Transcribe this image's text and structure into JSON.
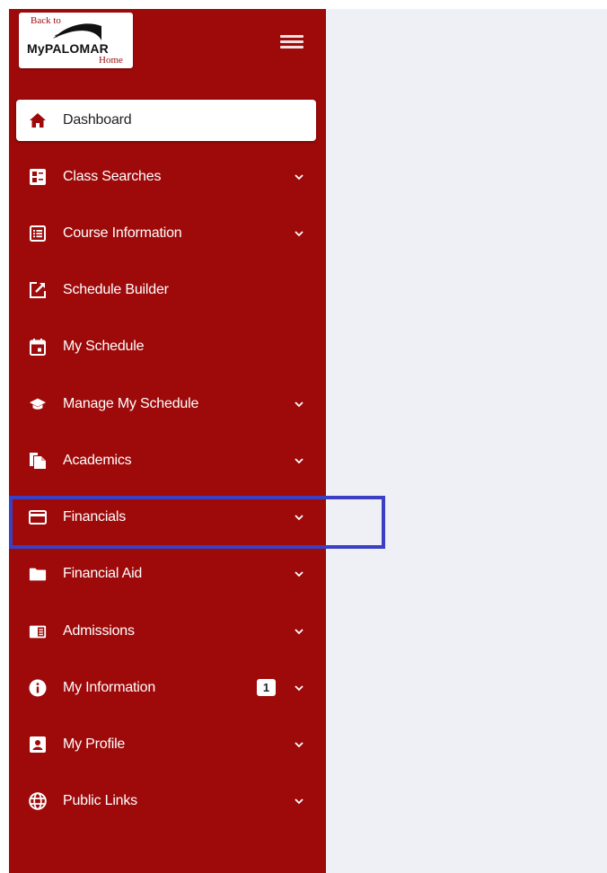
{
  "logo": {
    "back": "Back to",
    "brand": "MyPALOMAR",
    "home": "Home"
  },
  "colors": {
    "sidebar": "#9e0a0a",
    "main": "#eff0f6",
    "highlight": "#3b3fc4",
    "text": "#ffffff"
  },
  "nav": {
    "items": [
      {
        "label": "Dashboard",
        "icon": "home-icon",
        "active": true,
        "expandable": false
      },
      {
        "label": "Class Searches",
        "icon": "list-search-icon",
        "expandable": true
      },
      {
        "label": "Course Information",
        "icon": "list-icon",
        "expandable": true
      },
      {
        "label": "Schedule Builder",
        "icon": "edit-box-icon",
        "expandable": false
      },
      {
        "label": "My Schedule",
        "icon": "calendar-icon",
        "expandable": false
      },
      {
        "label": "Manage My Schedule",
        "icon": "graduation-cap-icon",
        "expandable": true
      },
      {
        "label": "Academics",
        "icon": "documents-icon",
        "expandable": true
      },
      {
        "label": "Financials",
        "icon": "credit-card-icon",
        "expandable": true,
        "highlighted": true
      },
      {
        "label": "Financial Aid",
        "icon": "folder-icon",
        "expandable": true
      },
      {
        "label": "Admissions",
        "icon": "id-card-icon",
        "expandable": true
      },
      {
        "label": "My Information",
        "icon": "info-icon",
        "expandable": true,
        "badge": "1"
      },
      {
        "label": "My Profile",
        "icon": "profile-icon",
        "expandable": true
      },
      {
        "label": "Public Links",
        "icon": "globe-icon",
        "expandable": true
      }
    ]
  }
}
